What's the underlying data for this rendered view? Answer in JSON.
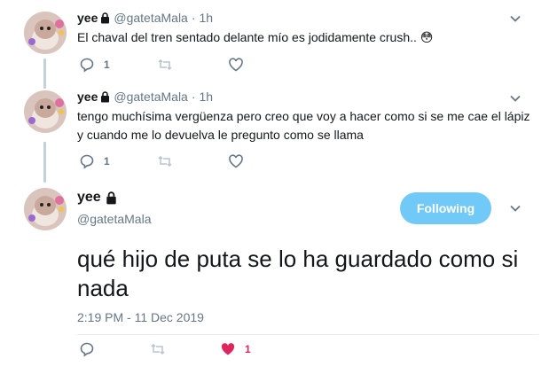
{
  "replies": [
    {
      "name": "yee",
      "handle": "@gatetaMala",
      "separator": "·",
      "time": "1h",
      "text": "El chaval del tren sentado delante mío es jodidamente crush.. 😳",
      "reply_count": "1",
      "retweet_count": "",
      "like_count": ""
    },
    {
      "name": "yee",
      "handle": "@gatetaMala",
      "separator": "·",
      "time": "1h",
      "text": "tengo muchísima vergüenza pero creo que voy a hacer como si se me cae el lápiz y cuando me lo devuelva le pregunto como se llama",
      "reply_count": "1",
      "retweet_count": "",
      "like_count": ""
    }
  ],
  "main_tweet": {
    "name": "yee",
    "handle": "@gatetaMala",
    "follow_label": "Following",
    "text": "qué hijo de puta se lo ha guardado como si nada",
    "date": "2:19 PM - 11 Dec 2019",
    "reply_count": "",
    "retweet_count": "",
    "like_count": "1"
  },
  "icons": {
    "reply": "reply-icon",
    "retweet": "retweet-icon",
    "like": "heart-icon",
    "liked": "heart-filled-icon",
    "lock": "lock-icon",
    "more": "chevron-down-icon"
  },
  "colors": {
    "follow_bg": "#71c9f8",
    "like_active": "#e0245e",
    "muted": "#657786",
    "thread_line": "#c4cfd6"
  }
}
